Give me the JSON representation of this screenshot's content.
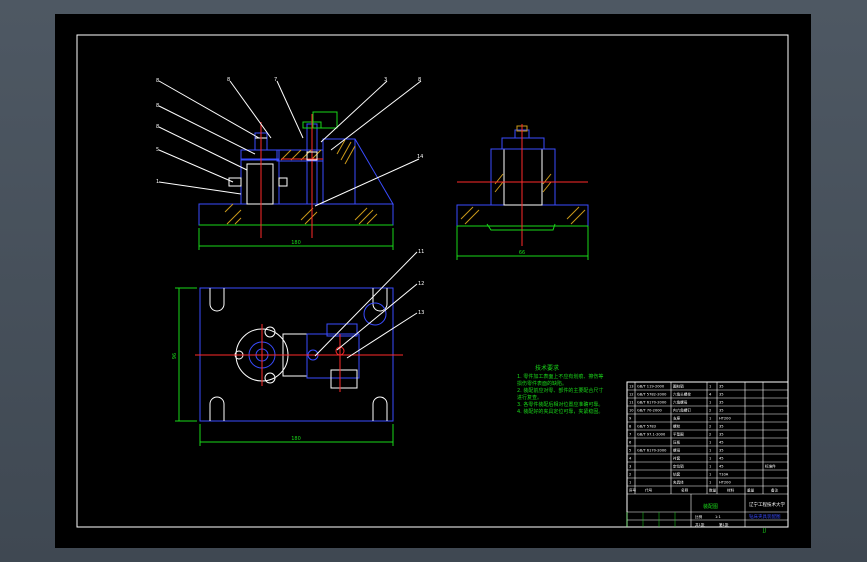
{
  "drawing": {
    "balloons_top": [
      "8",
      "8",
      "7",
      "3",
      "8"
    ],
    "balloons_left": [
      "8",
      "8",
      "5",
      "1"
    ],
    "balloon_right": "14",
    "balloons_plan": [
      "11",
      "12",
      "13"
    ],
    "dims": {
      "front_width": "180",
      "side_width": "66",
      "plan_width": "180",
      "plan_height": "96"
    }
  },
  "notes": {
    "title": "技术要求",
    "lines": [
      "1. 零件加工表面上不应有划痕、擦伤等",
      "损伤零件表面的缺陷。",
      "2. 装配前应对零、部件的主要配合尺寸",
      "进行复查。",
      "3. 各零件装配后相对位置应准确可靠。",
      "4. 装配好的夹具定位可靠，夹紧稳固。"
    ]
  },
  "title_block": {
    "parts": [
      {
        "no": "13",
        "code": "GB/T 119-2000",
        "name": "圆柱销",
        "qty": "1",
        "mat": "35"
      },
      {
        "no": "12",
        "code": "GB/T 5782-2000",
        "name": "六角头螺栓",
        "qty": "4",
        "mat": "35"
      },
      {
        "no": "11",
        "code": "GB/T 6170-2000",
        "name": "六角螺母",
        "qty": "1",
        "mat": "35"
      },
      {
        "no": "10",
        "code": "GB/T 70-2000",
        "name": "内六角螺钉",
        "qty": "2",
        "mat": "35"
      },
      {
        "no": "9",
        "code": "",
        "name": "支座",
        "qty": "1",
        "mat": "HT200"
      },
      {
        "no": "8",
        "code": "GB/T 5783",
        "name": "螺栓",
        "qty": "2",
        "mat": "35"
      },
      {
        "no": "7",
        "code": "GB/T 97.1-2000",
        "name": "平垫圈",
        "qty": "2",
        "mat": "35"
      },
      {
        "no": "6",
        "code": "",
        "name": "压板",
        "qty": "1",
        "mat": "45"
      },
      {
        "no": "5",
        "code": "GB/T 6170-2000",
        "name": "螺母",
        "qty": "1",
        "mat": "35"
      },
      {
        "no": "4",
        "code": "",
        "name": "衬套",
        "qty": "1",
        "mat": "45"
      },
      {
        "no": "3",
        "code": "",
        "name": "定位销",
        "qty": "1",
        "mat": "45"
      },
      {
        "no": "2",
        "code": "",
        "name": "钻套",
        "qty": "1",
        "mat": "T10A"
      },
      {
        "no": "1",
        "code": "",
        "name": "夹具体",
        "qty": "1",
        "mat": "HT200"
      }
    ],
    "header": {
      "no": "序号",
      "code": "代号",
      "name": "名称",
      "qty": "数量",
      "mat": "材料",
      "weight": "重量",
      "note": "备注"
    },
    "standard_note": "标准件",
    "school": "辽宁工程技术大学",
    "drawing_name": "钻床夹具装配图",
    "stamp": "装配图",
    "scale_label": "比例",
    "scale": "1:1",
    "sheet": "共1张",
    "sheet_no": "第1张",
    "bottom_code": "JJ"
  }
}
